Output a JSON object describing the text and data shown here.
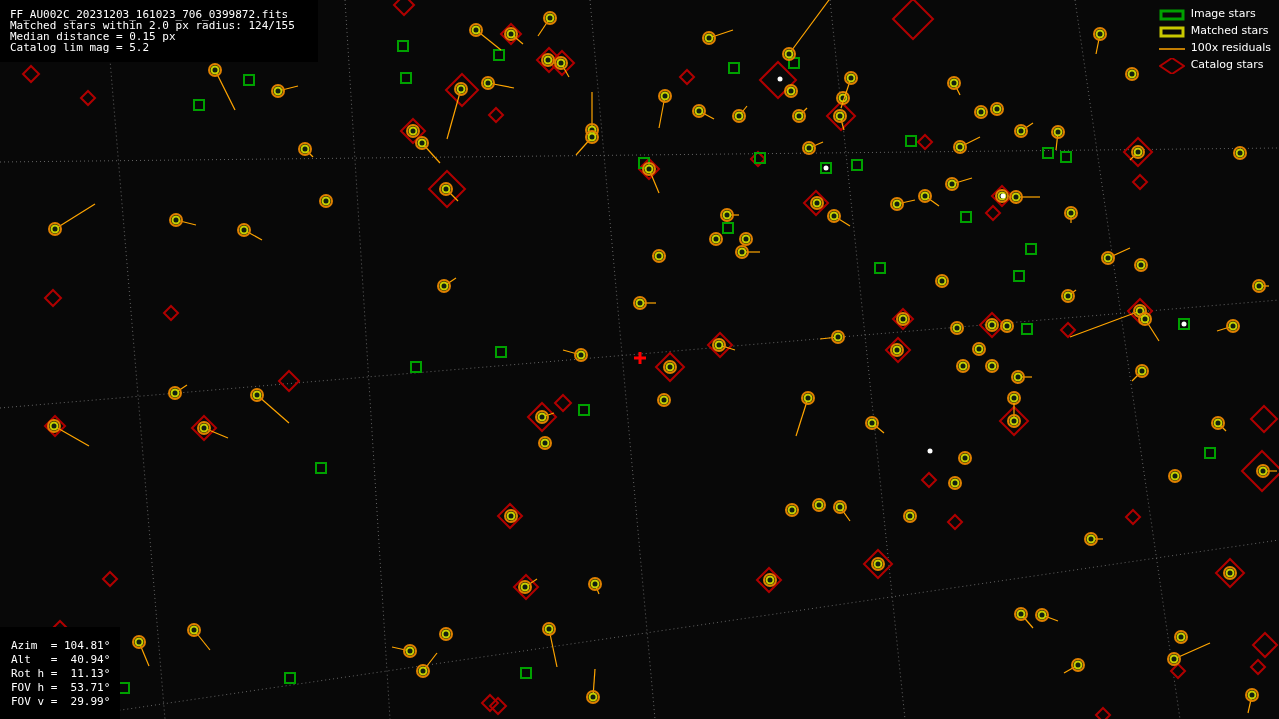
{
  "info": {
    "lines": [
      "FF_AU002C_20231203_161023_706_0399872.fits",
      "Matched stars within 2.0 px radius: 124/155",
      "Median distance = 0.15 px",
      "Catalog lim mag = 5.2"
    ]
  },
  "legend": [
    {
      "kind": "image",
      "label": "Image stars"
    },
    {
      "kind": "matched",
      "label": "Matched stars"
    },
    {
      "kind": "residual",
      "label": "100x residuals"
    },
    {
      "kind": "catalog",
      "label": "Catalog stars"
    }
  ],
  "pointing": {
    "lines": [
      "Azim  = 104.81°",
      "Alt   =  40.94°",
      "Rot h =  11.13°",
      "FOV h =  53.71°",
      "FOV v =  29.99°"
    ]
  }
}
